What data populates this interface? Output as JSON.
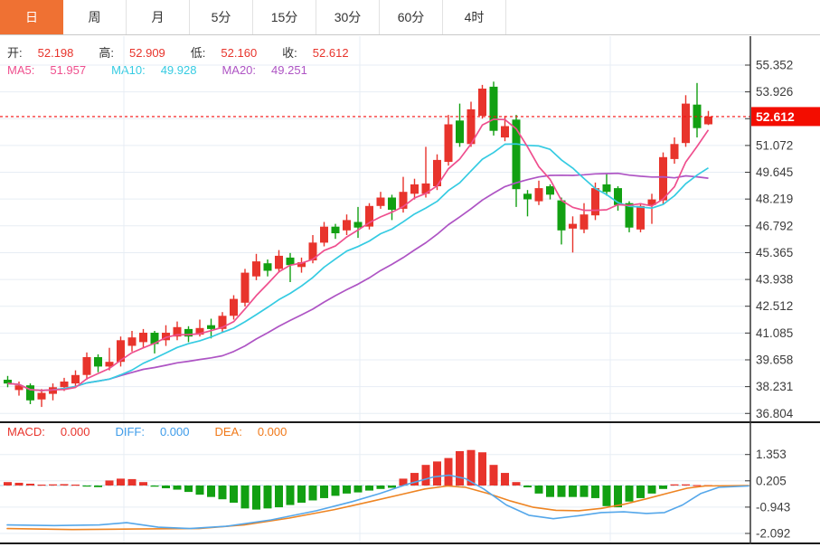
{
  "tabs": [
    {
      "label": "日",
      "active": true
    },
    {
      "label": "周",
      "active": false
    },
    {
      "label": "月",
      "active": false
    },
    {
      "label": "5分",
      "active": false
    },
    {
      "label": "15分",
      "active": false
    },
    {
      "label": "30分",
      "active": false
    },
    {
      "label": "60分",
      "active": false
    },
    {
      "label": "4时",
      "active": false
    }
  ],
  "colors": {
    "tab_active_bg": "#ef7133",
    "up": "#e8342c",
    "down": "#12a012",
    "ma5": "#ef4f8e",
    "ma10": "#35cbe2",
    "ma20": "#ae54c4",
    "diff": "#55a7ea",
    "dea": "#ee8422",
    "value_red": "#e8342c",
    "tag_bg": "#f30d00",
    "grid": "#e7edf4",
    "axis": "#333333",
    "tick_text": "#3c3c3c"
  },
  "header": {
    "ohlc": [
      {
        "label": "开:",
        "value": "52.198"
      },
      {
        "label": "高:",
        "value": "52.909"
      },
      {
        "label": "低:",
        "value": "52.160"
      },
      {
        "label": "收:",
        "value": "52.612"
      }
    ],
    "ma": [
      {
        "label": "MA5:",
        "value": "51.957",
        "color": "#ef4f8e"
      },
      {
        "label": "MA10:",
        "value": "49.928",
        "color": "#35cbe2"
      },
      {
        "label": "MA20:",
        "value": "49.251",
        "color": "#ae54c4"
      }
    ]
  },
  "macd_header": [
    {
      "label": "MACD:",
      "value": "0.000",
      "color": "#e8342c"
    },
    {
      "label": "DIFF:",
      "value": "0.000",
      "color": "#3d9be9"
    },
    {
      "label": "DEA:",
      "value": "0.000",
      "color": "#f07818"
    }
  ],
  "chart_data": {
    "type": "candlestick",
    "legend_position": "top-left-overlay",
    "grid": true,
    "price_axis": {
      "tick_labels": [
        "55.352",
        "53.926",
        "",
        "51.072",
        "49.645",
        "48.219",
        "46.792",
        "45.365",
        "43.938",
        "42.512",
        "41.085",
        "39.658",
        "38.231",
        "36.804"
      ],
      "tick_values": [
        55.352,
        53.926,
        52.499,
        51.072,
        49.645,
        48.219,
        46.792,
        45.365,
        43.938,
        42.512,
        41.085,
        39.658,
        38.231,
        36.804
      ],
      "range": [
        36.1,
        56.1
      ]
    },
    "current_price": "52.612",
    "current_price_value": 52.612,
    "ma_periods": [
      5,
      10,
      20
    ],
    "vertical_grid_x": [
      137,
      398,
      675
    ],
    "candles_ohlc": [
      [
        38.6,
        38.8,
        38.2,
        38.4
      ],
      [
        38.05,
        38.5,
        37.75,
        38.3
      ],
      [
        38.3,
        38.4,
        37.3,
        37.5
      ],
      [
        37.55,
        38.1,
        37.15,
        37.9
      ],
      [
        37.85,
        38.4,
        37.5,
        38.2
      ],
      [
        38.2,
        38.7,
        38.0,
        38.5
      ],
      [
        38.4,
        39.1,
        38.2,
        38.85
      ],
      [
        38.85,
        40.05,
        38.6,
        39.8
      ],
      [
        39.8,
        39.95,
        39.0,
        39.3
      ],
      [
        39.3,
        40.3,
        39.1,
        39.55
      ],
      [
        39.55,
        40.9,
        39.3,
        40.7
      ],
      [
        40.4,
        41.2,
        40.1,
        40.85
      ],
      [
        40.6,
        41.3,
        40.3,
        41.1
      ],
      [
        41.1,
        41.2,
        40.0,
        40.5
      ],
      [
        40.7,
        41.5,
        40.4,
        41.1
      ],
      [
        40.9,
        41.7,
        40.7,
        41.4
      ],
      [
        41.3,
        41.45,
        40.6,
        40.9
      ],
      [
        41.0,
        41.8,
        40.9,
        41.35
      ],
      [
        41.5,
        41.85,
        40.8,
        41.3
      ],
      [
        41.3,
        42.2,
        41.1,
        42.0
      ],
      [
        42.0,
        43.1,
        41.8,
        42.9
      ],
      [
        42.7,
        44.5,
        42.5,
        44.3
      ],
      [
        44.1,
        45.3,
        43.9,
        44.9
      ],
      [
        44.8,
        45.0,
        44.1,
        44.4
      ],
      [
        44.5,
        45.5,
        44.3,
        45.2
      ],
      [
        45.1,
        45.35,
        43.8,
        44.7
      ],
      [
        44.6,
        45.1,
        44.3,
        44.85
      ],
      [
        44.95,
        46.3,
        44.8,
        45.9
      ],
      [
        45.9,
        47.0,
        45.7,
        46.75
      ],
      [
        46.75,
        46.9,
        46.1,
        46.4
      ],
      [
        46.55,
        47.4,
        46.3,
        47.1
      ],
      [
        47.0,
        47.8,
        46.15,
        46.7
      ],
      [
        46.75,
        48.0,
        46.6,
        47.85
      ],
      [
        47.85,
        48.6,
        47.7,
        48.3
      ],
      [
        48.3,
        48.45,
        47.1,
        47.65
      ],
      [
        47.7,
        49.4,
        47.5,
        48.6
      ],
      [
        48.5,
        49.3,
        48.2,
        49.0
      ],
      [
        48.5,
        51.0,
        48.3,
        49.05
      ],
      [
        48.9,
        50.6,
        48.7,
        50.3
      ],
      [
        50.2,
        52.7,
        50.0,
        52.2
      ],
      [
        52.4,
        53.3,
        51.0,
        51.2
      ],
      [
        51.15,
        53.4,
        51.0,
        53.0
      ],
      [
        52.65,
        54.3,
        52.5,
        54.1
      ],
      [
        54.2,
        54.47,
        51.6,
        51.85
      ],
      [
        51.5,
        52.65,
        51.3,
        52.1
      ],
      [
        52.45,
        52.7,
        47.8,
        48.75
      ],
      [
        48.5,
        48.7,
        47.3,
        48.2
      ],
      [
        48.1,
        49.2,
        47.9,
        48.8
      ],
      [
        48.9,
        49.0,
        48.2,
        48.45
      ],
      [
        48.15,
        48.3,
        45.8,
        46.55
      ],
      [
        46.65,
        47.3,
        45.37,
        46.9
      ],
      [
        46.6,
        48.0,
        46.4,
        47.4
      ],
      [
        47.35,
        49.1,
        47.1,
        48.8
      ],
      [
        49.0,
        49.6,
        48.4,
        48.6
      ],
      [
        48.8,
        48.9,
        47.6,
        47.9
      ],
      [
        48.0,
        48.1,
        46.45,
        46.7
      ],
      [
        46.6,
        48.0,
        46.45,
        47.85
      ],
      [
        47.9,
        48.5,
        46.9,
        48.2
      ],
      [
        48.15,
        50.7,
        47.95,
        50.45
      ],
      [
        50.35,
        51.5,
        50.1,
        51.15
      ],
      [
        51.2,
        53.75,
        51.0,
        53.3
      ],
      [
        53.25,
        54.4,
        51.5,
        52.0
      ],
      [
        52.198,
        52.909,
        52.16,
        52.612
      ]
    ],
    "macd": {
      "axis_tick_labels": [
        "1.353",
        "0.205",
        "-0.943",
        "-2.092"
      ],
      "axis_tick_values": [
        1.353,
        0.205,
        -0.943,
        -2.092
      ],
      "hist": [
        0.15,
        0.12,
        0.08,
        0.04,
        0.05,
        0.06,
        0.04,
        -0.04,
        -0.07,
        0.22,
        0.3,
        0.28,
        0.15,
        -0.05,
        -0.12,
        -0.18,
        -0.28,
        -0.4,
        -0.5,
        -0.6,
        -0.75,
        -1.0,
        -1.05,
        -1.0,
        -0.95,
        -0.85,
        -0.75,
        -0.65,
        -0.55,
        -0.45,
        -0.35,
        -0.3,
        -0.22,
        -0.15,
        -0.1,
        0.3,
        0.55,
        0.9,
        1.05,
        1.2,
        1.5,
        1.55,
        1.45,
        0.9,
        0.55,
        0.15,
        -0.08,
        -0.35,
        -0.5,
        -0.5,
        -0.5,
        -0.5,
        -0.55,
        -0.9,
        -0.95,
        -0.7,
        -0.55,
        -0.35,
        -0.15,
        0.05,
        0.05,
        0.02,
        0.02
      ],
      "diff_line": [
        [
          8,
          -1.72
        ],
        [
          60,
          -1.75
        ],
        [
          110,
          -1.72
        ],
        [
          140,
          -1.62
        ],
        [
          175,
          -1.82
        ],
        [
          210,
          -1.88
        ],
        [
          250,
          -1.78
        ],
        [
          300,
          -1.5
        ],
        [
          350,
          -1.1
        ],
        [
          390,
          -0.7
        ],
        [
          420,
          -0.35
        ],
        [
          450,
          0.05
        ],
        [
          480,
          0.38
        ],
        [
          497,
          0.45
        ],
        [
          515,
          0.3
        ],
        [
          535,
          -0.15
        ],
        [
          560,
          -0.85
        ],
        [
          585,
          -1.3
        ],
        [
          612,
          -1.45
        ],
        [
          640,
          -1.32
        ],
        [
          665,
          -1.18
        ],
        [
          690,
          -1.15
        ],
        [
          715,
          -1.22
        ],
        [
          735,
          -1.18
        ],
        [
          755,
          -0.85
        ],
        [
          775,
          -0.35
        ],
        [
          795,
          -0.08
        ],
        [
          828,
          -0.02
        ]
      ],
      "dea_line": [
        [
          8,
          -1.88
        ],
        [
          80,
          -1.92
        ],
        [
          150,
          -1.9
        ],
        [
          220,
          -1.88
        ],
        [
          270,
          -1.72
        ],
        [
          320,
          -1.42
        ],
        [
          370,
          -1.05
        ],
        [
          410,
          -0.7
        ],
        [
          445,
          -0.38
        ],
        [
          470,
          -0.15
        ],
        [
          495,
          -0.02
        ],
        [
          515,
          -0.08
        ],
        [
          540,
          -0.35
        ],
        [
          565,
          -0.68
        ],
        [
          590,
          -0.95
        ],
        [
          615,
          -1.08
        ],
        [
          640,
          -1.1
        ],
        [
          665,
          -1.0
        ],
        [
          690,
          -0.82
        ],
        [
          715,
          -0.58
        ],
        [
          740,
          -0.32
        ],
        [
          760,
          -0.12
        ],
        [
          780,
          -0.02
        ],
        [
          828,
          0.0
        ]
      ]
    }
  }
}
